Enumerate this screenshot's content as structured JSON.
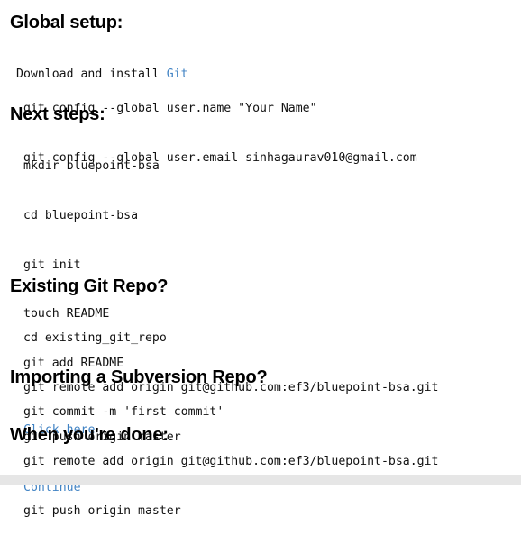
{
  "global_setup": {
    "heading": "Global setup:",
    "download_prefix": "Download and install ",
    "git_link": "Git",
    "lines": [
      "git config --global user.name \"Your Name\"",
      "git config --global user.email sinhagaurav010@gmail.com"
    ]
  },
  "next_steps": {
    "heading": "Next steps:",
    "lines": [
      "mkdir bluepoint-bsa",
      "cd bluepoint-bsa",
      "git init",
      "touch README",
      "git add README",
      "git commit -m 'first commit'",
      "git remote add origin git@github.com:ef3/bluepoint-bsa.git",
      "git push origin master"
    ]
  },
  "existing_repo": {
    "heading": "Existing Git Repo?",
    "lines": [
      "cd existing_git_repo",
      "git remote add origin git@github.com:ef3/bluepoint-bsa.git",
      "git push origin master"
    ]
  },
  "subversion": {
    "heading": "Importing a Subversion Repo?",
    "link": "Click here"
  },
  "done": {
    "heading": "When you're done:",
    "link": "Continue"
  },
  "colors": {
    "link": "#4183c4",
    "footer_bar": "#e6e6e6"
  }
}
